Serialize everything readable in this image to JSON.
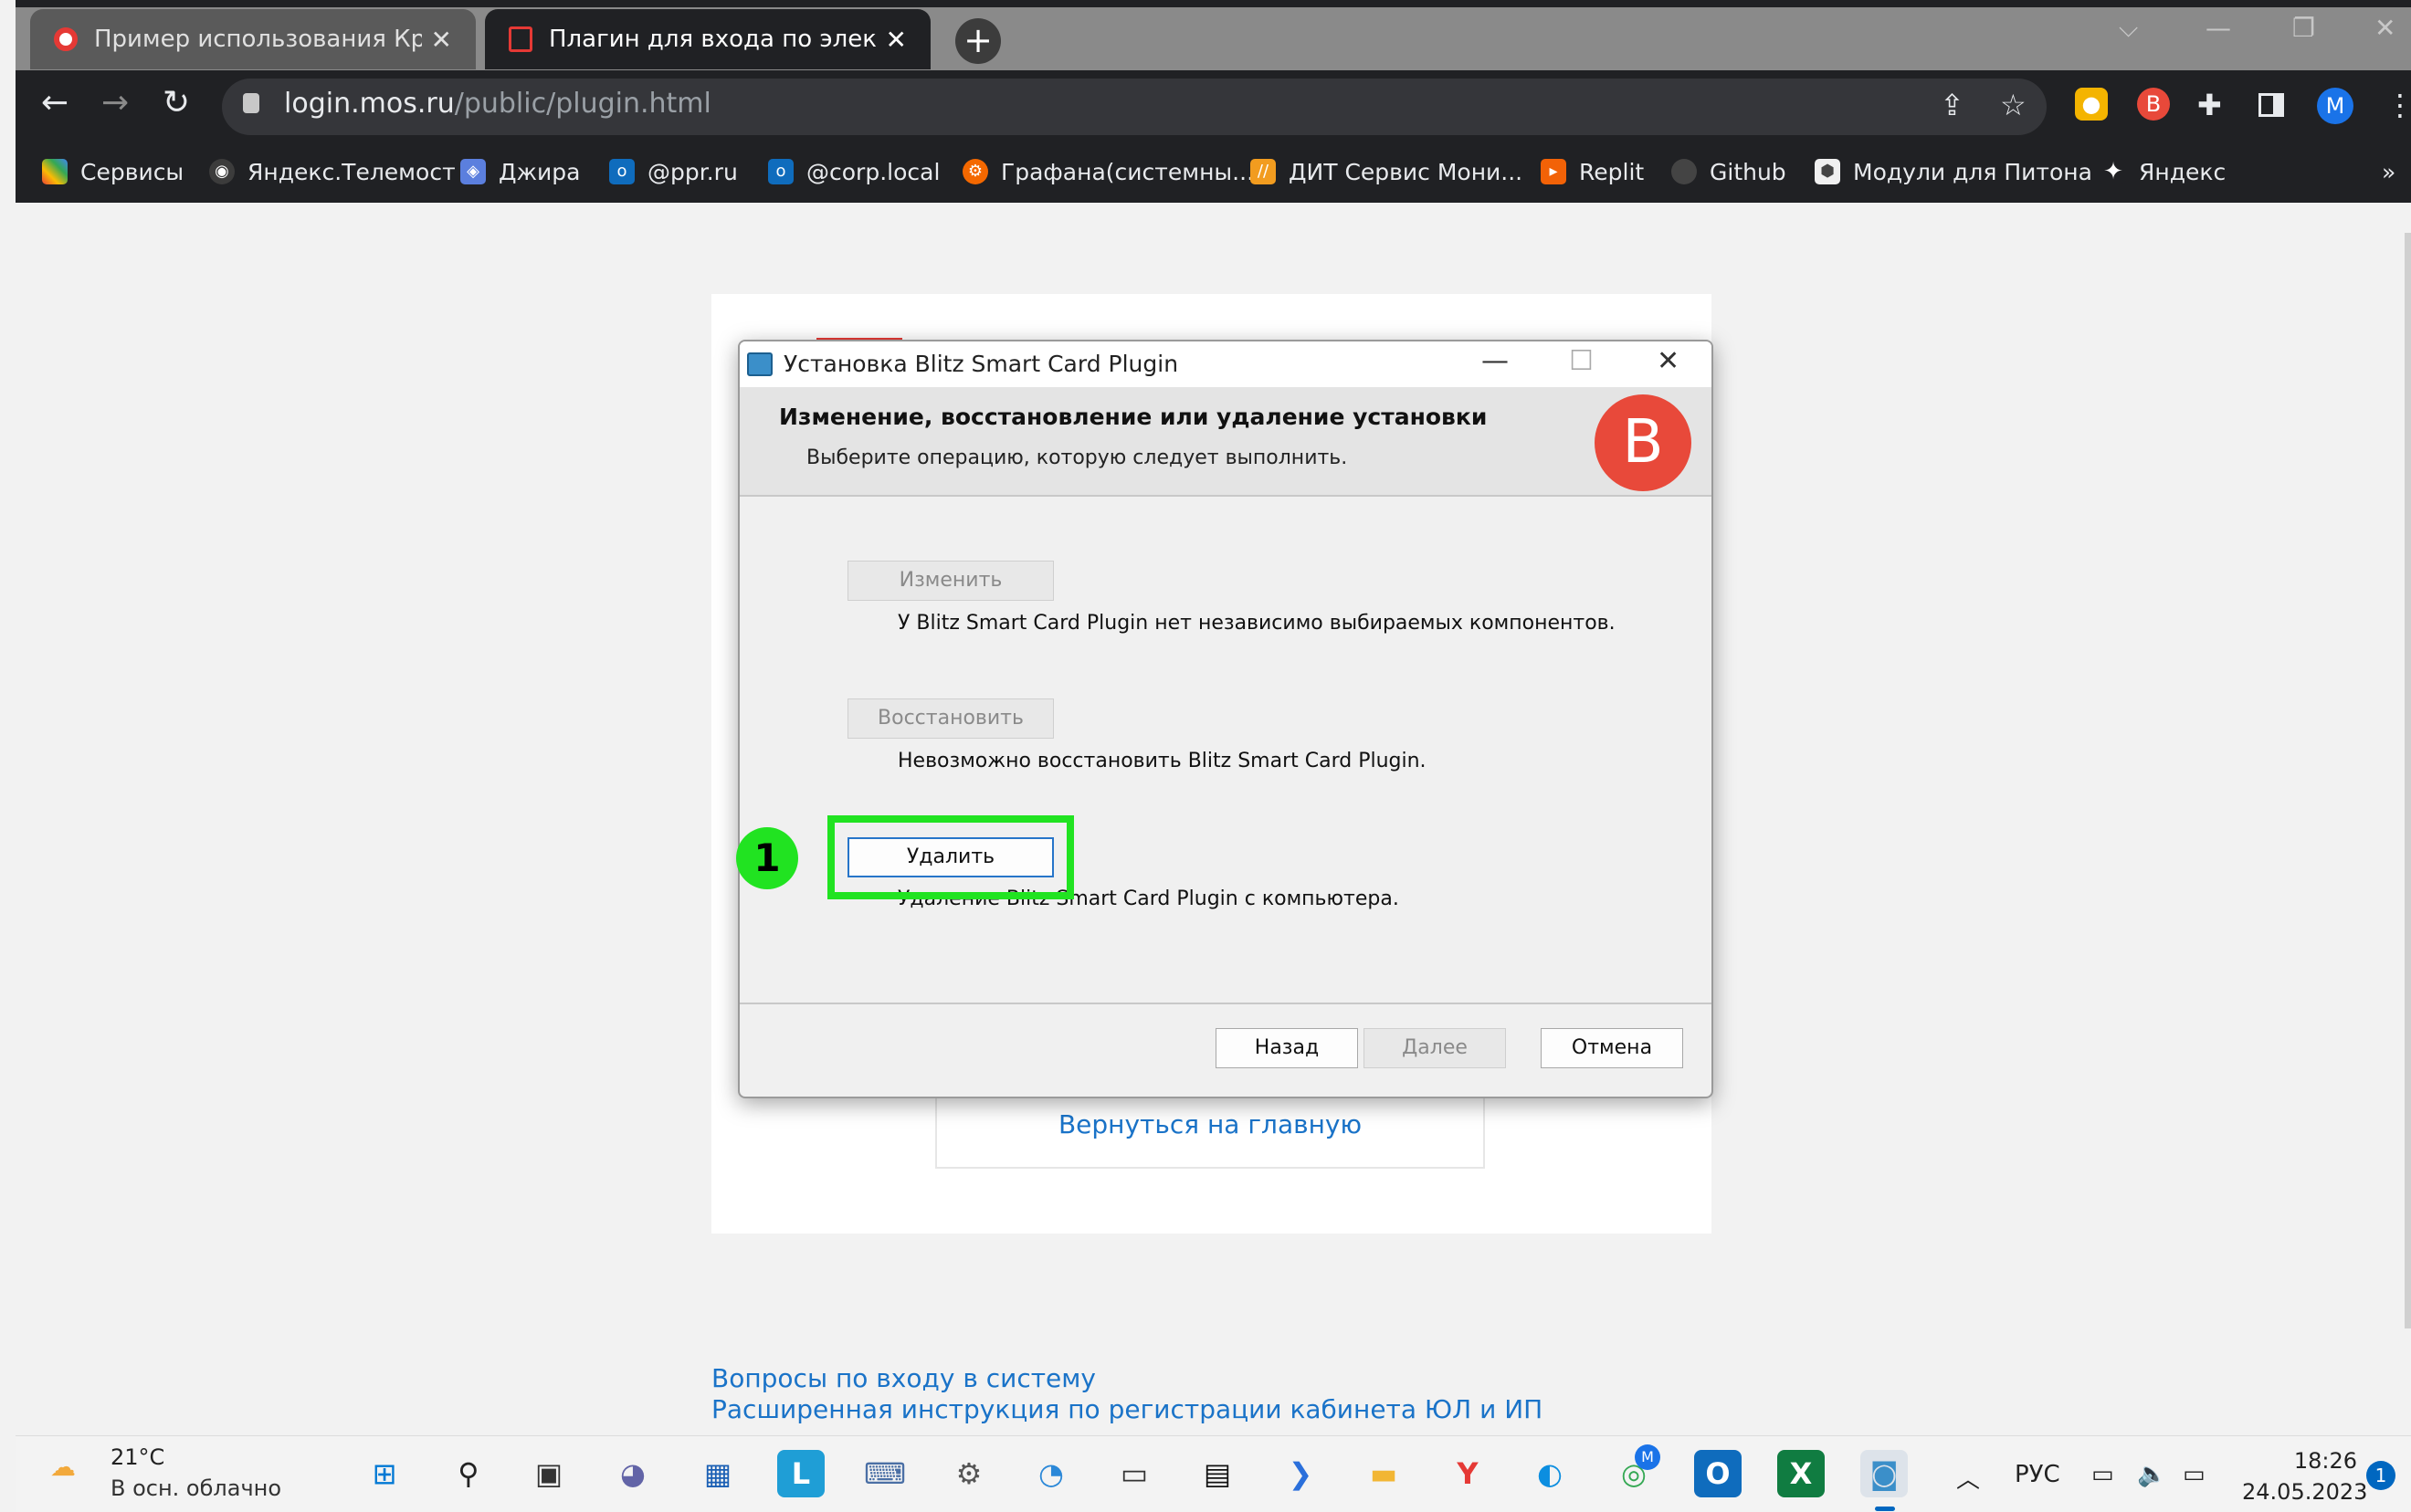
{
  "browser": {
    "tabs": [
      {
        "title": "Пример использования Крипто"
      },
      {
        "title": "Плагин для входа по электронн"
      }
    ],
    "new_tab": "+",
    "close_glyph": "✕",
    "url_domain": "login.mos.ru",
    "url_path": "/public/plugin.html",
    "bookmarks": [
      {
        "label": "Сервисы",
        "icon": "apps-grid-icon",
        "color": "#e94235"
      },
      {
        "label": "Яндекс.Телемост",
        "icon": "telemost-icon",
        "color": "#3c3c3c"
      },
      {
        "label": "Джира",
        "icon": "jira-icon",
        "color": "#5b7fde"
      },
      {
        "label": "@ppr.ru",
        "icon": "outlook-icon",
        "color": "#0f6cbd"
      },
      {
        "label": "@corp.local",
        "icon": "outlook-icon",
        "color": "#0f6cbd"
      },
      {
        "label": "Графана(системны...",
        "icon": "grafana-icon",
        "color": "#f46800"
      },
      {
        "label": "ДИТ Сервис Мони...",
        "icon": "dit-icon",
        "color": "#f29c1f"
      },
      {
        "label": "Replit",
        "icon": "replit-icon",
        "color": "#f26207"
      },
      {
        "label": "Github",
        "icon": "github-icon",
        "color": "#444"
      },
      {
        "label": "Модули для Питона",
        "icon": "cube-icon",
        "color": "#f0f0f0"
      },
      {
        "label": "Яндекс",
        "icon": "star-sparkle-icon",
        "color": "#111"
      }
    ],
    "more": "»",
    "profile_initial": "M"
  },
  "page": {
    "back_link": "Вернуться на главную",
    "footer_links": [
      "Вопросы по входу в систему",
      "Расширенная инструкция по регистрации кабинета ЮЛ и ИП"
    ]
  },
  "dialog": {
    "title": "Установка Blitz Smart Card Plugin",
    "header_title": "Изменение, восстановление или удаление установки",
    "header_subtitle": "Выберите операцию, которую следует выполнить.",
    "logo_letter": "B",
    "change_button": "Изменить",
    "change_desc": "У Blitz Smart Card Plugin нет независимо выбираемых компонентов.",
    "repair_button": "Восстановить",
    "repair_desc": "Невозможно восстановить Blitz Smart Card Plugin.",
    "remove_button": "Удалить",
    "remove_desc": "Удаление Blitz Smart Card Plugin с компьютера.",
    "back_button": "Назад",
    "next_button": "Далее",
    "cancel_button": "Отмена",
    "accent_color": "#2775c9"
  },
  "annotation": {
    "badge": "1",
    "color": "#21e321"
  },
  "taskbar": {
    "temperature": "21°C",
    "weather": "В осн. облачно",
    "language": "РУС",
    "time": "18:26",
    "date": "24.05.2023",
    "notifications": "1",
    "chrome_badge": "M"
  }
}
